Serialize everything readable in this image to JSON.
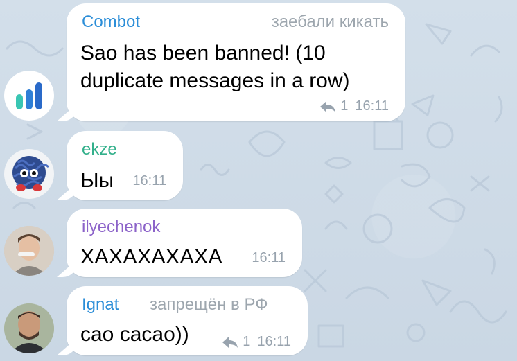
{
  "colors": {
    "combot": "#2c8ed8",
    "ekze": "#33b08b",
    "ilyechenok": "#8c63c9",
    "ignat": "#2c8ed8",
    "meta": "#98a3ae"
  },
  "messages": [
    {
      "sender": "Combot",
      "tag": "заебали кикать",
      "text_line_1": "Sao has been banned! (10",
      "text_line_2": "duplicate messages in a row)",
      "replies": "1",
      "time": "16:11"
    },
    {
      "sender": "ekze",
      "text": "Ыы",
      "time": "16:11"
    },
    {
      "sender": "ilyechenok",
      "text": "ХАХАХАХАХА",
      "time": "16:11"
    },
    {
      "sender": "Ignat",
      "tag": "запрещён в РФ",
      "text": "сао сасао))",
      "replies": "1",
      "time": "16:11"
    }
  ]
}
